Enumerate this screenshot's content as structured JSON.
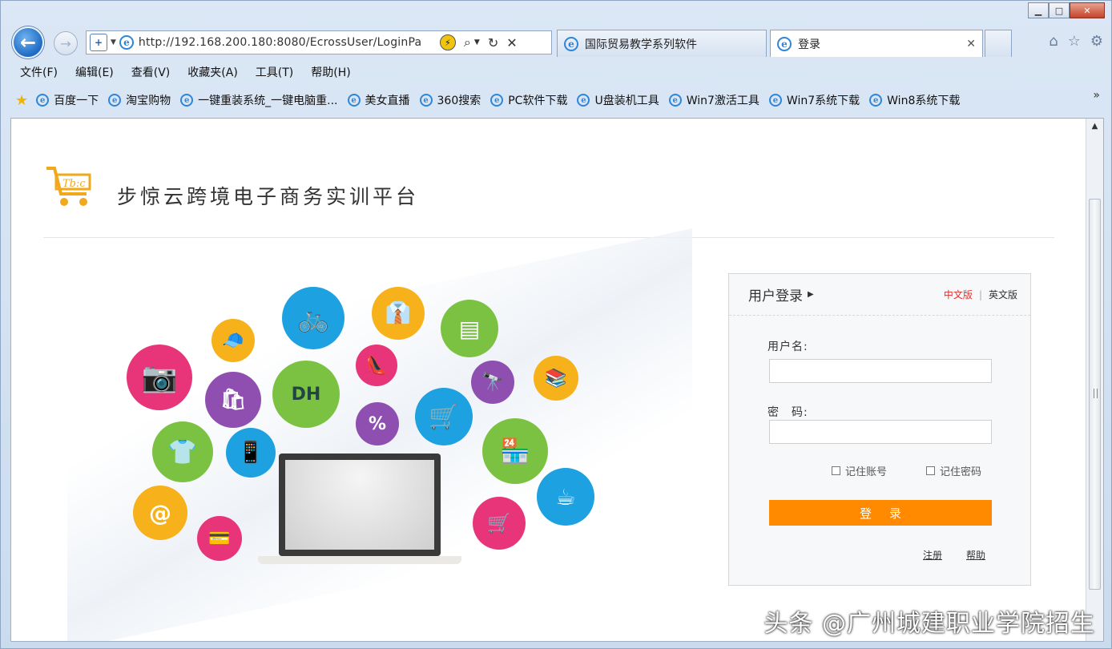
{
  "browser": {
    "address_url": "http://192.168.200.180:8080/EcrossUser/LoginPa",
    "tabs": [
      {
        "label": "国际贸易教学系列软件",
        "active": false
      },
      {
        "label": "登录",
        "active": true
      }
    ],
    "menu": [
      "文件(F)",
      "编辑(E)",
      "查看(V)",
      "收藏夹(A)",
      "工具(T)",
      "帮助(H)"
    ],
    "favorites": [
      "百度一下",
      "淘宝购物",
      "一键重装系统_一键电脑重...",
      "美女直播",
      "360搜索",
      "PC软件下载",
      "U盘装机工具",
      "Win7激活工具",
      "Win7系统下载",
      "Win8系统下载"
    ],
    "favorites_more": "»",
    "caption": {
      "minimize": "▁",
      "maximize": "□",
      "close": "✕"
    }
  },
  "page": {
    "site_title": "步惊云跨境电子商务实训平台",
    "logo_text": "Tb:c",
    "hero_dh_label": "DH",
    "login": {
      "title": "用户登录",
      "lang_cn": "中文版",
      "lang_sep": "|",
      "lang_en": "英文版",
      "username_label": "用户名:",
      "username_value": "",
      "password_label": "密　码:",
      "password_value": "",
      "remember_account": "记住账号",
      "remember_password": "记住密码",
      "submit": "登录",
      "register": "注册",
      "help": "帮助"
    }
  },
  "watermark": "头条 @广州城建职业学院招生",
  "colors": {
    "accent_orange": "#ff8a00",
    "lang_active": "#e0302b",
    "bubble_pink": "#e8357a",
    "bubble_purple": "#8e4fb0",
    "bubble_blue": "#1da1e0",
    "bubble_green": "#7cc242",
    "bubble_yellow": "#f7b21b"
  }
}
